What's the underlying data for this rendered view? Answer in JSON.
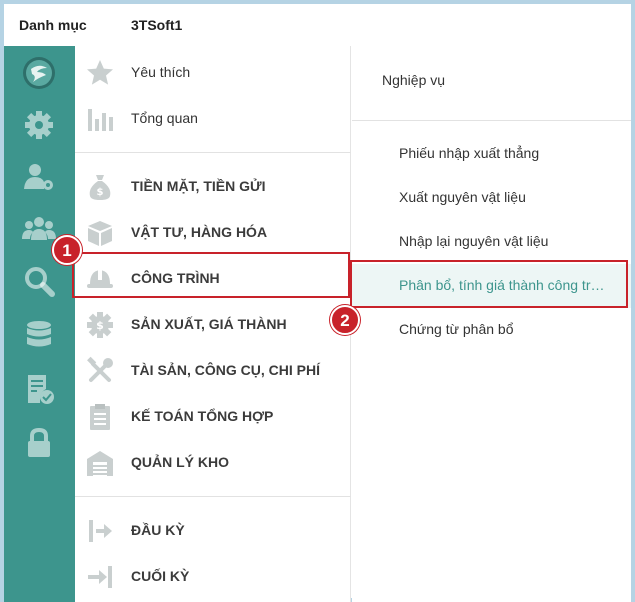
{
  "header": {
    "section_label": "Danh mục",
    "company": "3TSoft1"
  },
  "sidebar_icons": [
    "logo-icon",
    "gear-icon",
    "user-settings-icon",
    "group-icon",
    "search-icon",
    "database-icon",
    "report-check-icon",
    "lock-icon"
  ],
  "menu": {
    "favorites": "Yêu thích",
    "overview": "Tổng quan",
    "items": [
      {
        "label": "TIỀN MẶT, TIỀN GỬI",
        "icon": "money-bag-icon"
      },
      {
        "label": "VẬT TƯ, HÀNG HÓA",
        "icon": "box-icon"
      },
      {
        "label": "CÔNG TRÌNH",
        "icon": "helmet-icon"
      },
      {
        "label": "SẢN XUẤT, GIÁ THÀNH",
        "icon": "gear-dollar-icon"
      },
      {
        "label": "TÀI SẢN, CÔNG CỤ, CHI PHÍ",
        "icon": "tools-icon"
      },
      {
        "label": "KẾ TOÁN TỔNG HỢP",
        "icon": "clipboard-icon"
      },
      {
        "label": "QUẢN LÝ KHO",
        "icon": "warehouse-icon"
      }
    ],
    "period_start": "ĐẦU KỲ",
    "period_end": "CUỐI KỲ"
  },
  "panel": {
    "heading": "Nghiệp vụ",
    "items": [
      "Phiếu nhập xuất thẳng",
      "Xuất nguyên vật liệu",
      "Nhập lại nguyên vật liệu",
      "Phân bổ, tính giá thành công tr…",
      "Chứng từ phân bổ"
    ],
    "selected_index": 3
  },
  "annotations": {
    "step1": "1",
    "step2": "2"
  },
  "colors": {
    "sidebar": "#3d958d",
    "highlight": "#c8222a",
    "selected_bg": "#edf6f5",
    "selected_text": "#3d958d",
    "menu_icon": "#c9cfcf"
  }
}
